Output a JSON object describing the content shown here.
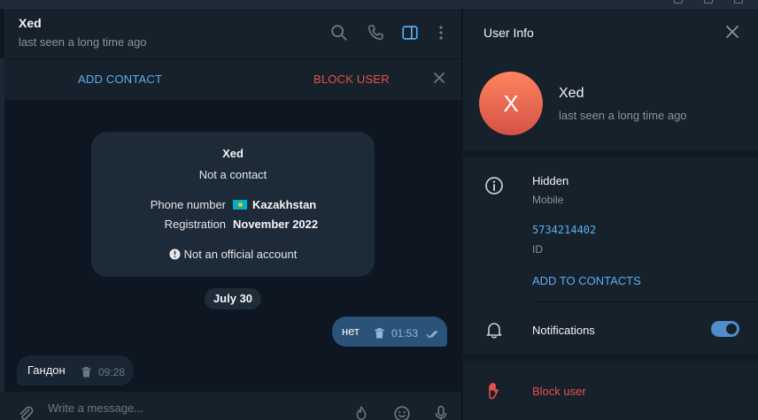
{
  "chat": {
    "name": "Xed",
    "status": "last seen a long time ago",
    "add_contact": "ADD CONTACT",
    "block_user": "BLOCK USER"
  },
  "card": {
    "name": "Xed",
    "subtitle": "Not a contact",
    "phone_label": "Phone number",
    "phone_value": "Kazakhstan",
    "reg_label": "Registration",
    "reg_value": "November 2022",
    "official": "Not an official account"
  },
  "date_pill": "July 30",
  "messages": [
    {
      "direction": "out",
      "text": "нет",
      "time": "01:53"
    },
    {
      "direction": "in",
      "text": "Гандон",
      "time": "09:28"
    }
  ],
  "composer": {
    "placeholder": "Write a message..."
  },
  "user_info": {
    "title": "User Info",
    "avatar_letter": "X",
    "name": "Xed",
    "status": "last seen a long time ago",
    "phone": "Hidden",
    "phone_label": "Mobile",
    "id": "5734214402",
    "id_label": "ID",
    "add_to_contacts": "ADD TO CONTACTS",
    "notifications": "Notifications",
    "notifications_on": true,
    "block_user": "Block user"
  },
  "colors": {
    "accent": "#5aaef2",
    "danger": "#e5524a",
    "bubble_out": "#2b5278",
    "avatar": "#e5654e"
  }
}
